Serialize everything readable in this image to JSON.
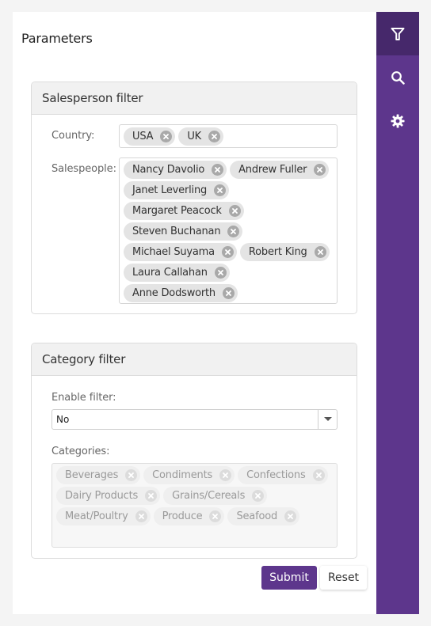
{
  "page": {
    "title": "Parameters"
  },
  "sidebar": {
    "items": [
      {
        "icon": "filter-icon",
        "active": true
      },
      {
        "icon": "search-icon",
        "active": false
      },
      {
        "icon": "gear-icon",
        "active": false
      }
    ]
  },
  "salesperson_filter": {
    "header": "Salesperson filter",
    "country_label": "Country:",
    "countries": [
      "USA",
      "UK"
    ],
    "salespeople_label": "Salespeople:",
    "salespeople": [
      "Nancy Davolio",
      "Andrew Fuller",
      "Janet Leverling",
      "Margaret Peacock",
      "Steven Buchanan",
      "Michael Suyama",
      "Robert King",
      "Laura Callahan",
      "Anne Dodsworth"
    ]
  },
  "category_filter": {
    "header": "Category filter",
    "enable_label": "Enable filter:",
    "enable_value": "No",
    "categories_label": "Categories:",
    "categories": [
      "Beverages",
      "Condiments",
      "Confections",
      "Dairy Products",
      "Grains/Cereals",
      "Meat/Poultry",
      "Produce",
      "Seafood"
    ],
    "categories_disabled": true
  },
  "actions": {
    "submit": "Submit",
    "reset": "Reset"
  },
  "colors": {
    "accent": "#5d368c",
    "accent_dark": "#46286b"
  }
}
